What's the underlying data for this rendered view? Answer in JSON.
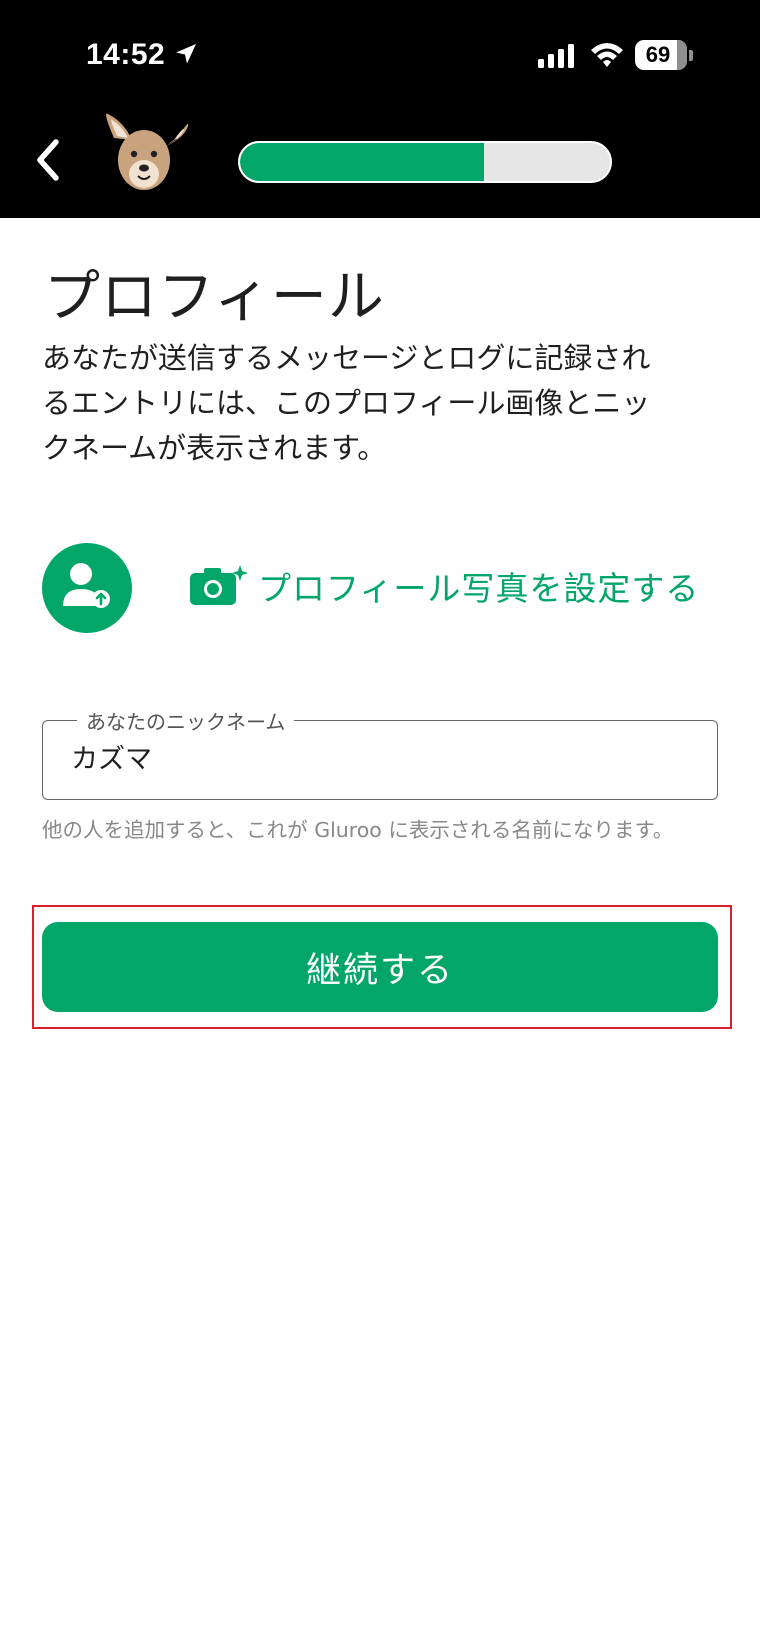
{
  "status_bar": {
    "time": "14:52",
    "battery": "69",
    "icons": [
      "location-arrow-icon",
      "signal-bars-icon",
      "wifi-icon",
      "battery-icon"
    ]
  },
  "header": {
    "back_icon": "chevron-left-icon",
    "logo": "kangaroo-mascot-icon",
    "progress_fraction": 0.66,
    "colors": {
      "background": "#000000",
      "progress_fill": "#02a668",
      "progress_track": "#e6e6e6"
    }
  },
  "main": {
    "title": "プロフィール",
    "description_lines": [
      "あなたが送信するメッセージとログに記録され",
      "るエントリには、このプロフィール画像とニッ",
      "クネームが表示されます。"
    ],
    "avatar_icon": "person-upload-icon",
    "photo_button": {
      "icon": "camera-sparkle-icon",
      "label": "プロフィール写真を設定する"
    },
    "nickname": {
      "label": "あなたのニックネーム",
      "value": "カズマ"
    },
    "helper_text": "他の人を追加すると、これが Gluroo に表示される名前になります。",
    "continue_label": "継続する"
  },
  "colors": {
    "accent": "#02a668",
    "highlight": "#d81f2a"
  }
}
